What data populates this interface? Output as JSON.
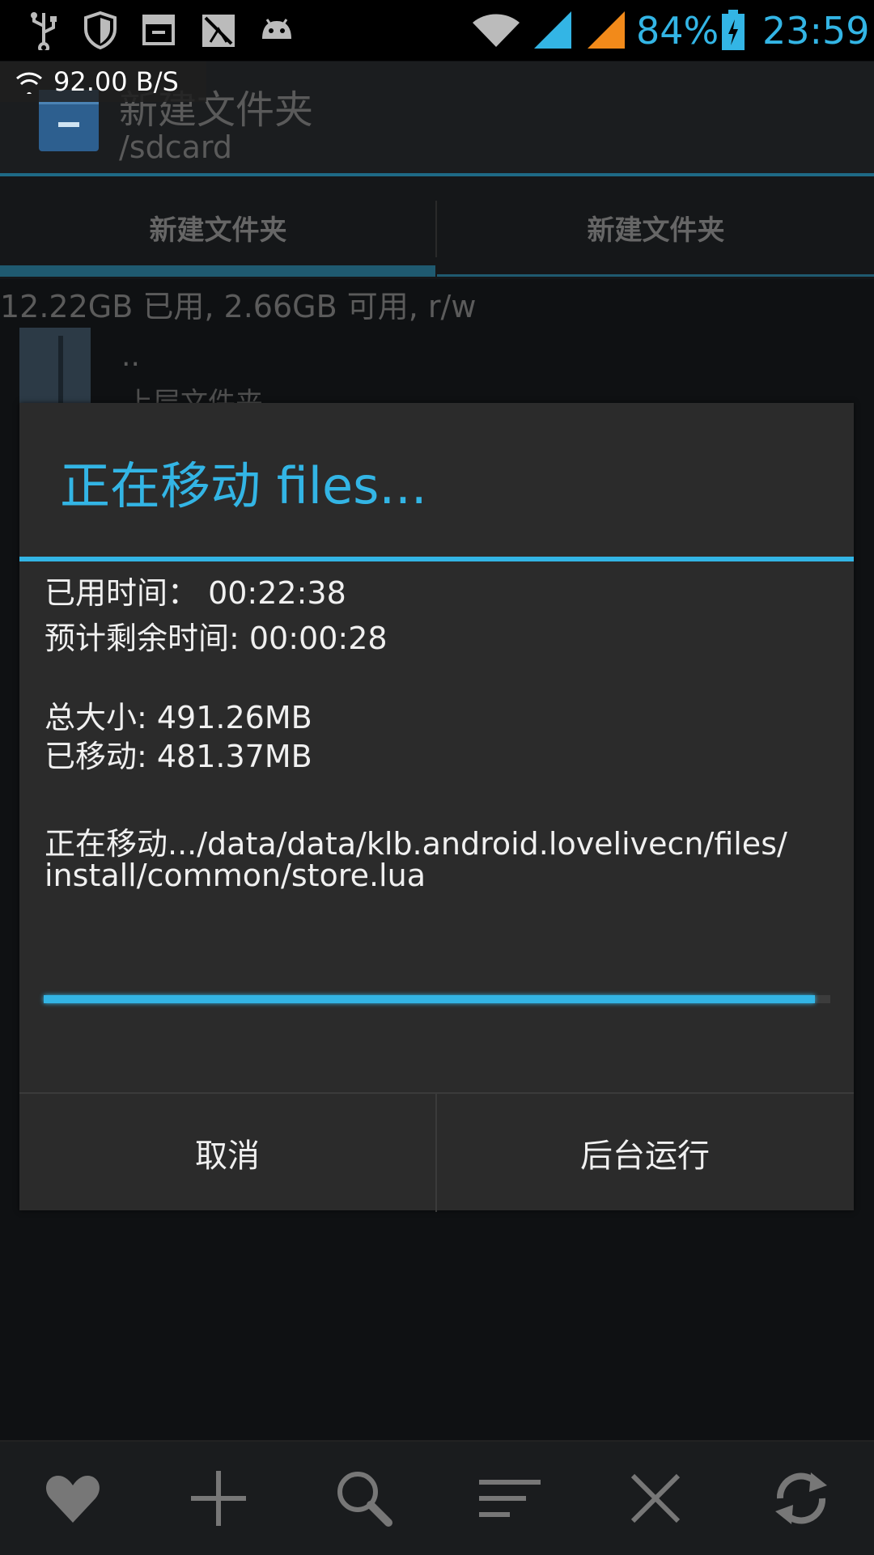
{
  "status_bar": {
    "battery_percent": "84%",
    "time": "23:59",
    "left_icons": [
      "usb-icon",
      "shield-icon",
      "archive-icon",
      "disabled-app-icon",
      "android-icon"
    ],
    "right_icons": [
      "wifi-icon",
      "signal-blue-icon",
      "signal-orange-icon",
      "battery-icon"
    ],
    "accent_color": "#33b5e5"
  },
  "speed_overlay": {
    "text": "92.00 B/S"
  },
  "action_bar": {
    "title": "新建文件夹",
    "subtitle": "/sdcard"
  },
  "tabs": [
    {
      "label": "新建文件夹",
      "selected": true
    },
    {
      "label": "新建文件夹",
      "selected": false
    }
  ],
  "storage_info": "12.22GB 已用, 2.66GB 可用, r/w",
  "file_list": [
    {
      "name": "..",
      "subtitle": "上层文件夹"
    }
  ],
  "dialog": {
    "title": "正在移动 files...",
    "elapsed": "已用时间： 00:22:38",
    "remaining": "预计剩余时间: 00:00:28",
    "total_size": "总大小: 491.26MB",
    "moved": "已移动: 481.37MB",
    "current_file_line1": "正在移动.../data/data/klb.android.lovelivecn/files/",
    "current_file_line2": "install/common/store.lua",
    "progress": 0.98,
    "cancel_label": "取消",
    "background_label": "后台运行"
  },
  "bottom_toolbar": {
    "icons": [
      "heart-icon",
      "plus-icon",
      "search-icon",
      "sort-icon",
      "close-icon",
      "refresh-icon"
    ]
  }
}
